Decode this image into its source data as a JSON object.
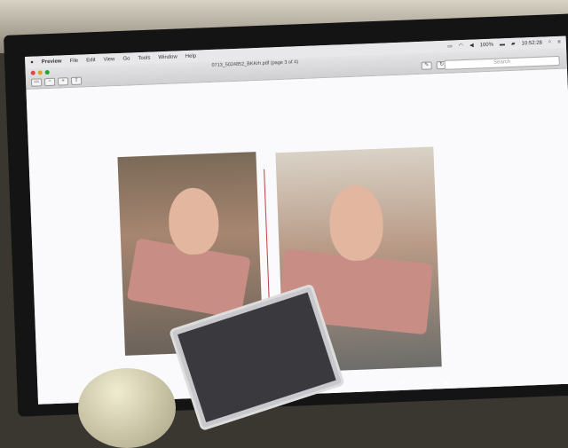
{
  "menubar": {
    "apple": "",
    "items": [
      "Preview",
      "File",
      "Edit",
      "View",
      "Go",
      "Tools",
      "Window",
      "Help"
    ],
    "status": {
      "battery": "100%",
      "time": "10:52:28"
    }
  },
  "window": {
    "title": "0713_5024852_BKKrh.pdf (page 3 of 4)",
    "search_placeholder": "Search"
  },
  "colors": {
    "close": "#e0443e",
    "minimize": "#dea123",
    "zoom": "#1aab29"
  }
}
